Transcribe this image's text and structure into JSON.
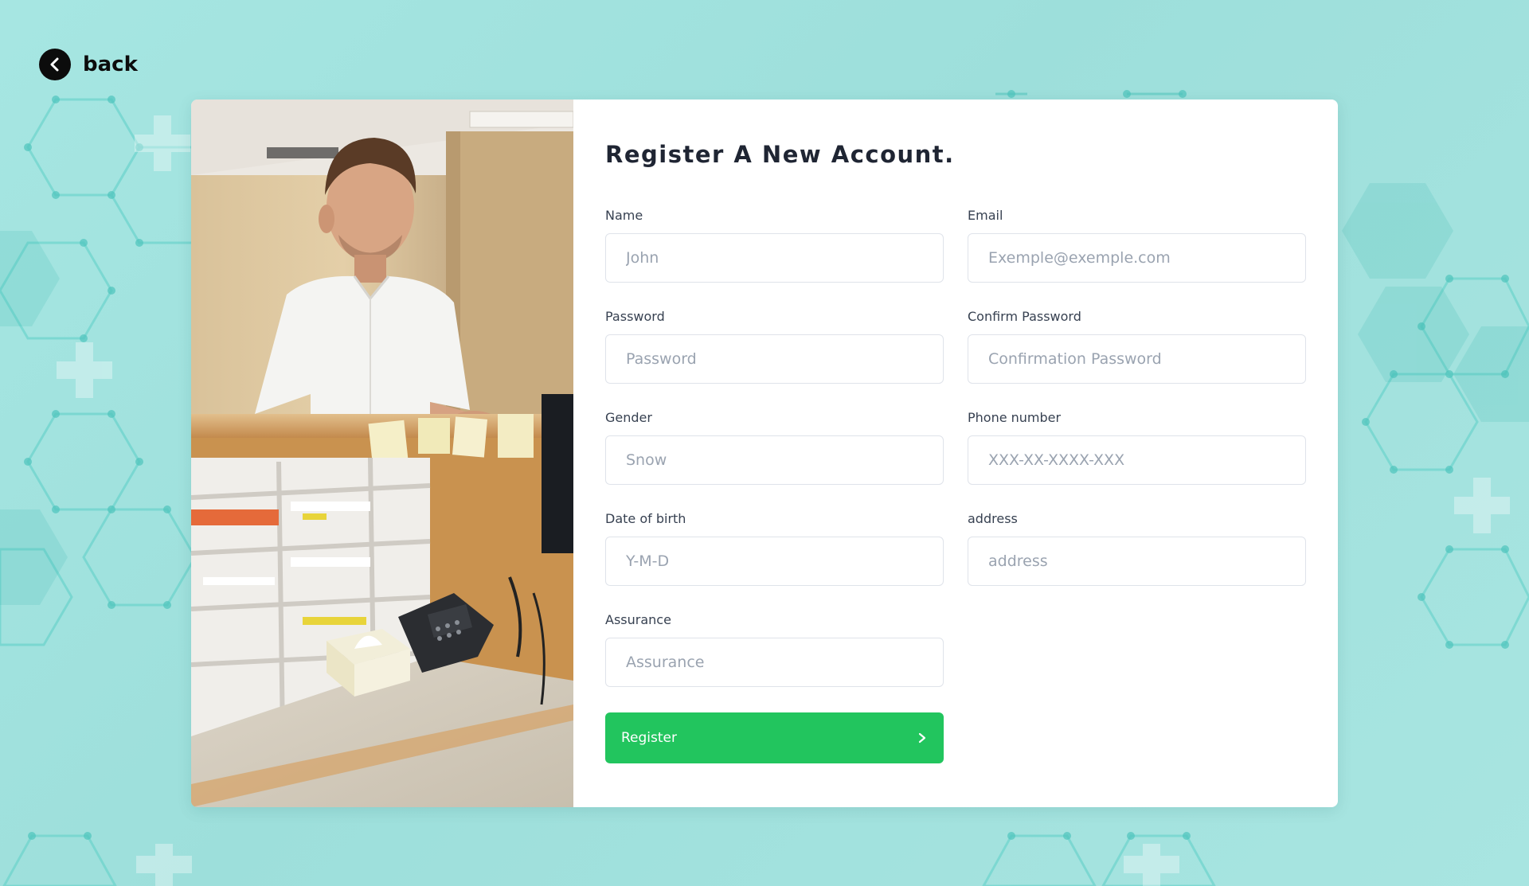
{
  "nav": {
    "back_label": "back"
  },
  "form": {
    "title": "Register A New Account.",
    "fields": {
      "name": {
        "label": "Name",
        "placeholder": "John"
      },
      "email": {
        "label": "Email",
        "placeholder": "Exemple@exemple.com"
      },
      "password": {
        "label": "Password",
        "placeholder": "Password"
      },
      "confirm_password": {
        "label": "Confirm Password",
        "placeholder": "Confirmation Password"
      },
      "gender": {
        "label": "Gender",
        "placeholder": "Snow"
      },
      "phone": {
        "label": "Phone number",
        "placeholder": "XXX-XX-XXXX-XXX"
      },
      "dob": {
        "label": "Date of birth",
        "placeholder": "Y-M-D"
      },
      "address": {
        "label": "address",
        "placeholder": "address"
      },
      "assurance": {
        "label": "Assurance",
        "placeholder": "Assurance"
      }
    },
    "submit_label": "Register"
  },
  "icons": {
    "back": "chevron-left-icon",
    "submit": "chevron-right-icon"
  },
  "colors": {
    "background": "#a6e6e2",
    "accent_green": "#22c55e",
    "title_text": "#1f2533",
    "back_circle": "#0c0c0c"
  }
}
